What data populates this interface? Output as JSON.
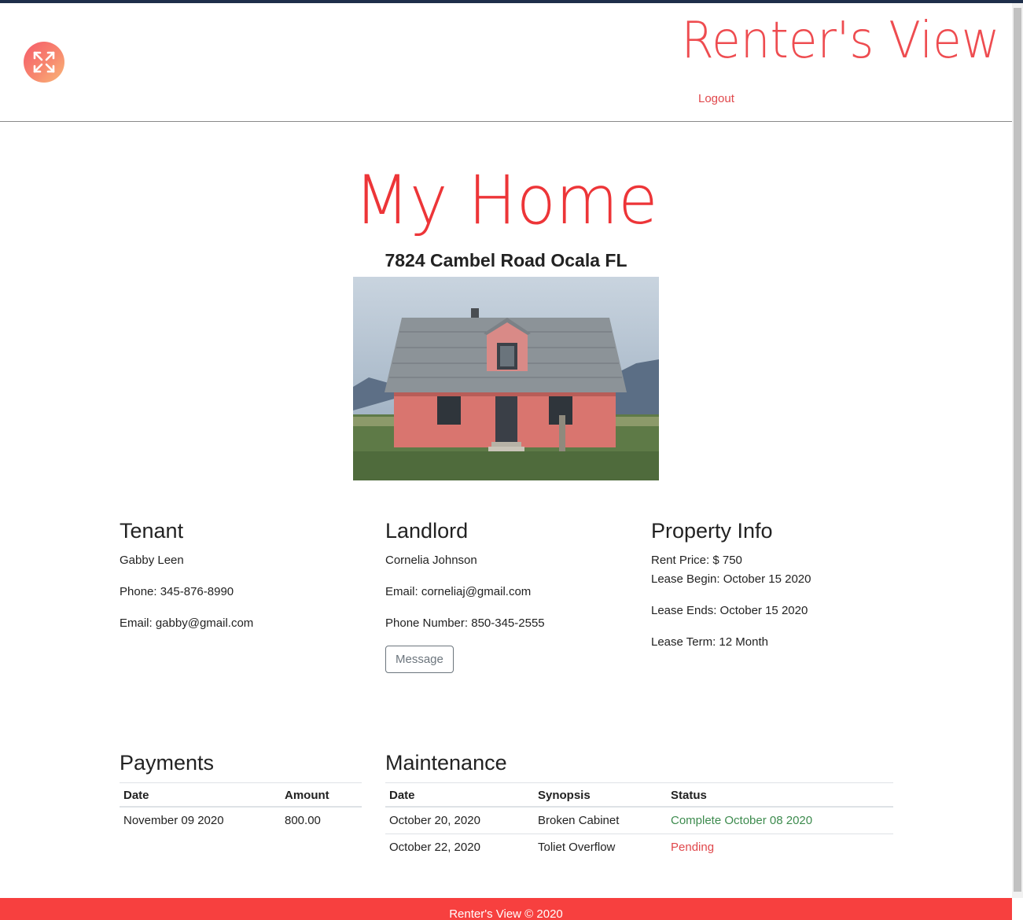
{
  "header": {
    "brand": "Renter's View",
    "logout_label": "Logout",
    "logo_icon": "expand-arrows-icon"
  },
  "page": {
    "title": "My Home",
    "address": "7824 Cambel Road Ocala FL"
  },
  "tenant": {
    "heading": "Tenant",
    "name": "Gabby Leen",
    "phone": "Phone: 345-876-8990",
    "email": "Email: gabby@gmail.com"
  },
  "landlord": {
    "heading": "Landlord",
    "name": "Cornelia Johnson",
    "email": "Email: corneliaj@gmail.com",
    "phone": "Phone Number: 850-345-2555",
    "message_label": "Message"
  },
  "property": {
    "heading": "Property Info",
    "rent": "Rent Price: $ 750",
    "lease_begin": "Lease Begin: October 15 2020",
    "lease_ends": "Lease Ends: October 15 2020",
    "lease_term": "Lease Term: 12 Month"
  },
  "payments": {
    "heading": "Payments",
    "columns": [
      "Date",
      "Amount"
    ],
    "rows": [
      [
        "November 09 2020",
        "800.00"
      ]
    ]
  },
  "maintenance": {
    "heading": "Maintenance",
    "columns": [
      "Date",
      "Synopsis",
      "Status"
    ],
    "rows": [
      [
        "October 20, 2020",
        "Broken Cabinet",
        "Complete October 08 2020"
      ],
      [
        "October 22, 2020",
        "Toliet Overflow",
        "Pending"
      ]
    ]
  },
  "footer": {
    "text": "Renter's View © 2020"
  },
  "colors": {
    "brand": "#ee4c50",
    "footer": "#f7403f",
    "complete": "#3d8b4e",
    "pending": "#e0474b"
  }
}
